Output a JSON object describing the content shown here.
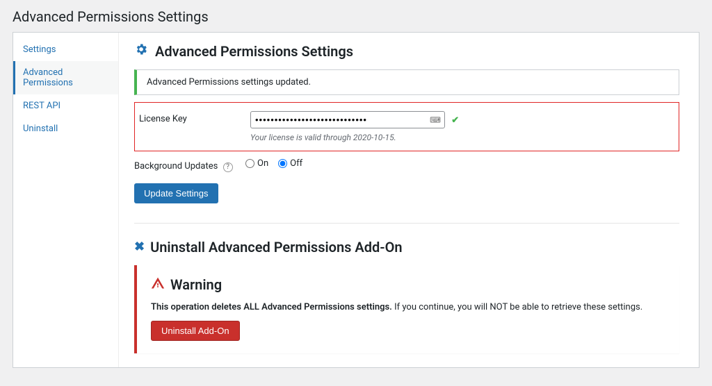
{
  "pageTitle": "Advanced Permissions Settings",
  "sidebar": {
    "items": [
      {
        "label": "Settings"
      },
      {
        "label": "Advanced Permissions"
      },
      {
        "label": "REST API"
      },
      {
        "label": "Uninstall"
      }
    ]
  },
  "settingsSection": {
    "title": "Advanced Permissions Settings",
    "notice": "Advanced Permissions settings updated.",
    "licenseLabel": "License Key",
    "licenseValue": "•••••••••••••••••••••••••••••",
    "licenseStatus": "Your license is valid through 2020-10-15.",
    "bgUpdatesLabel": "Background Updates",
    "onLabel": "On",
    "offLabel": "Off",
    "submitLabel": "Update Settings"
  },
  "uninstallSection": {
    "title": "Uninstall Advanced Permissions Add-On",
    "warningTitle": "Warning",
    "warningBold": "This operation deletes ALL Advanced Permissions settings.",
    "warningRest": " If you continue, you will NOT be able to retrieve these settings.",
    "buttonLabel": "Uninstall Add-On"
  }
}
